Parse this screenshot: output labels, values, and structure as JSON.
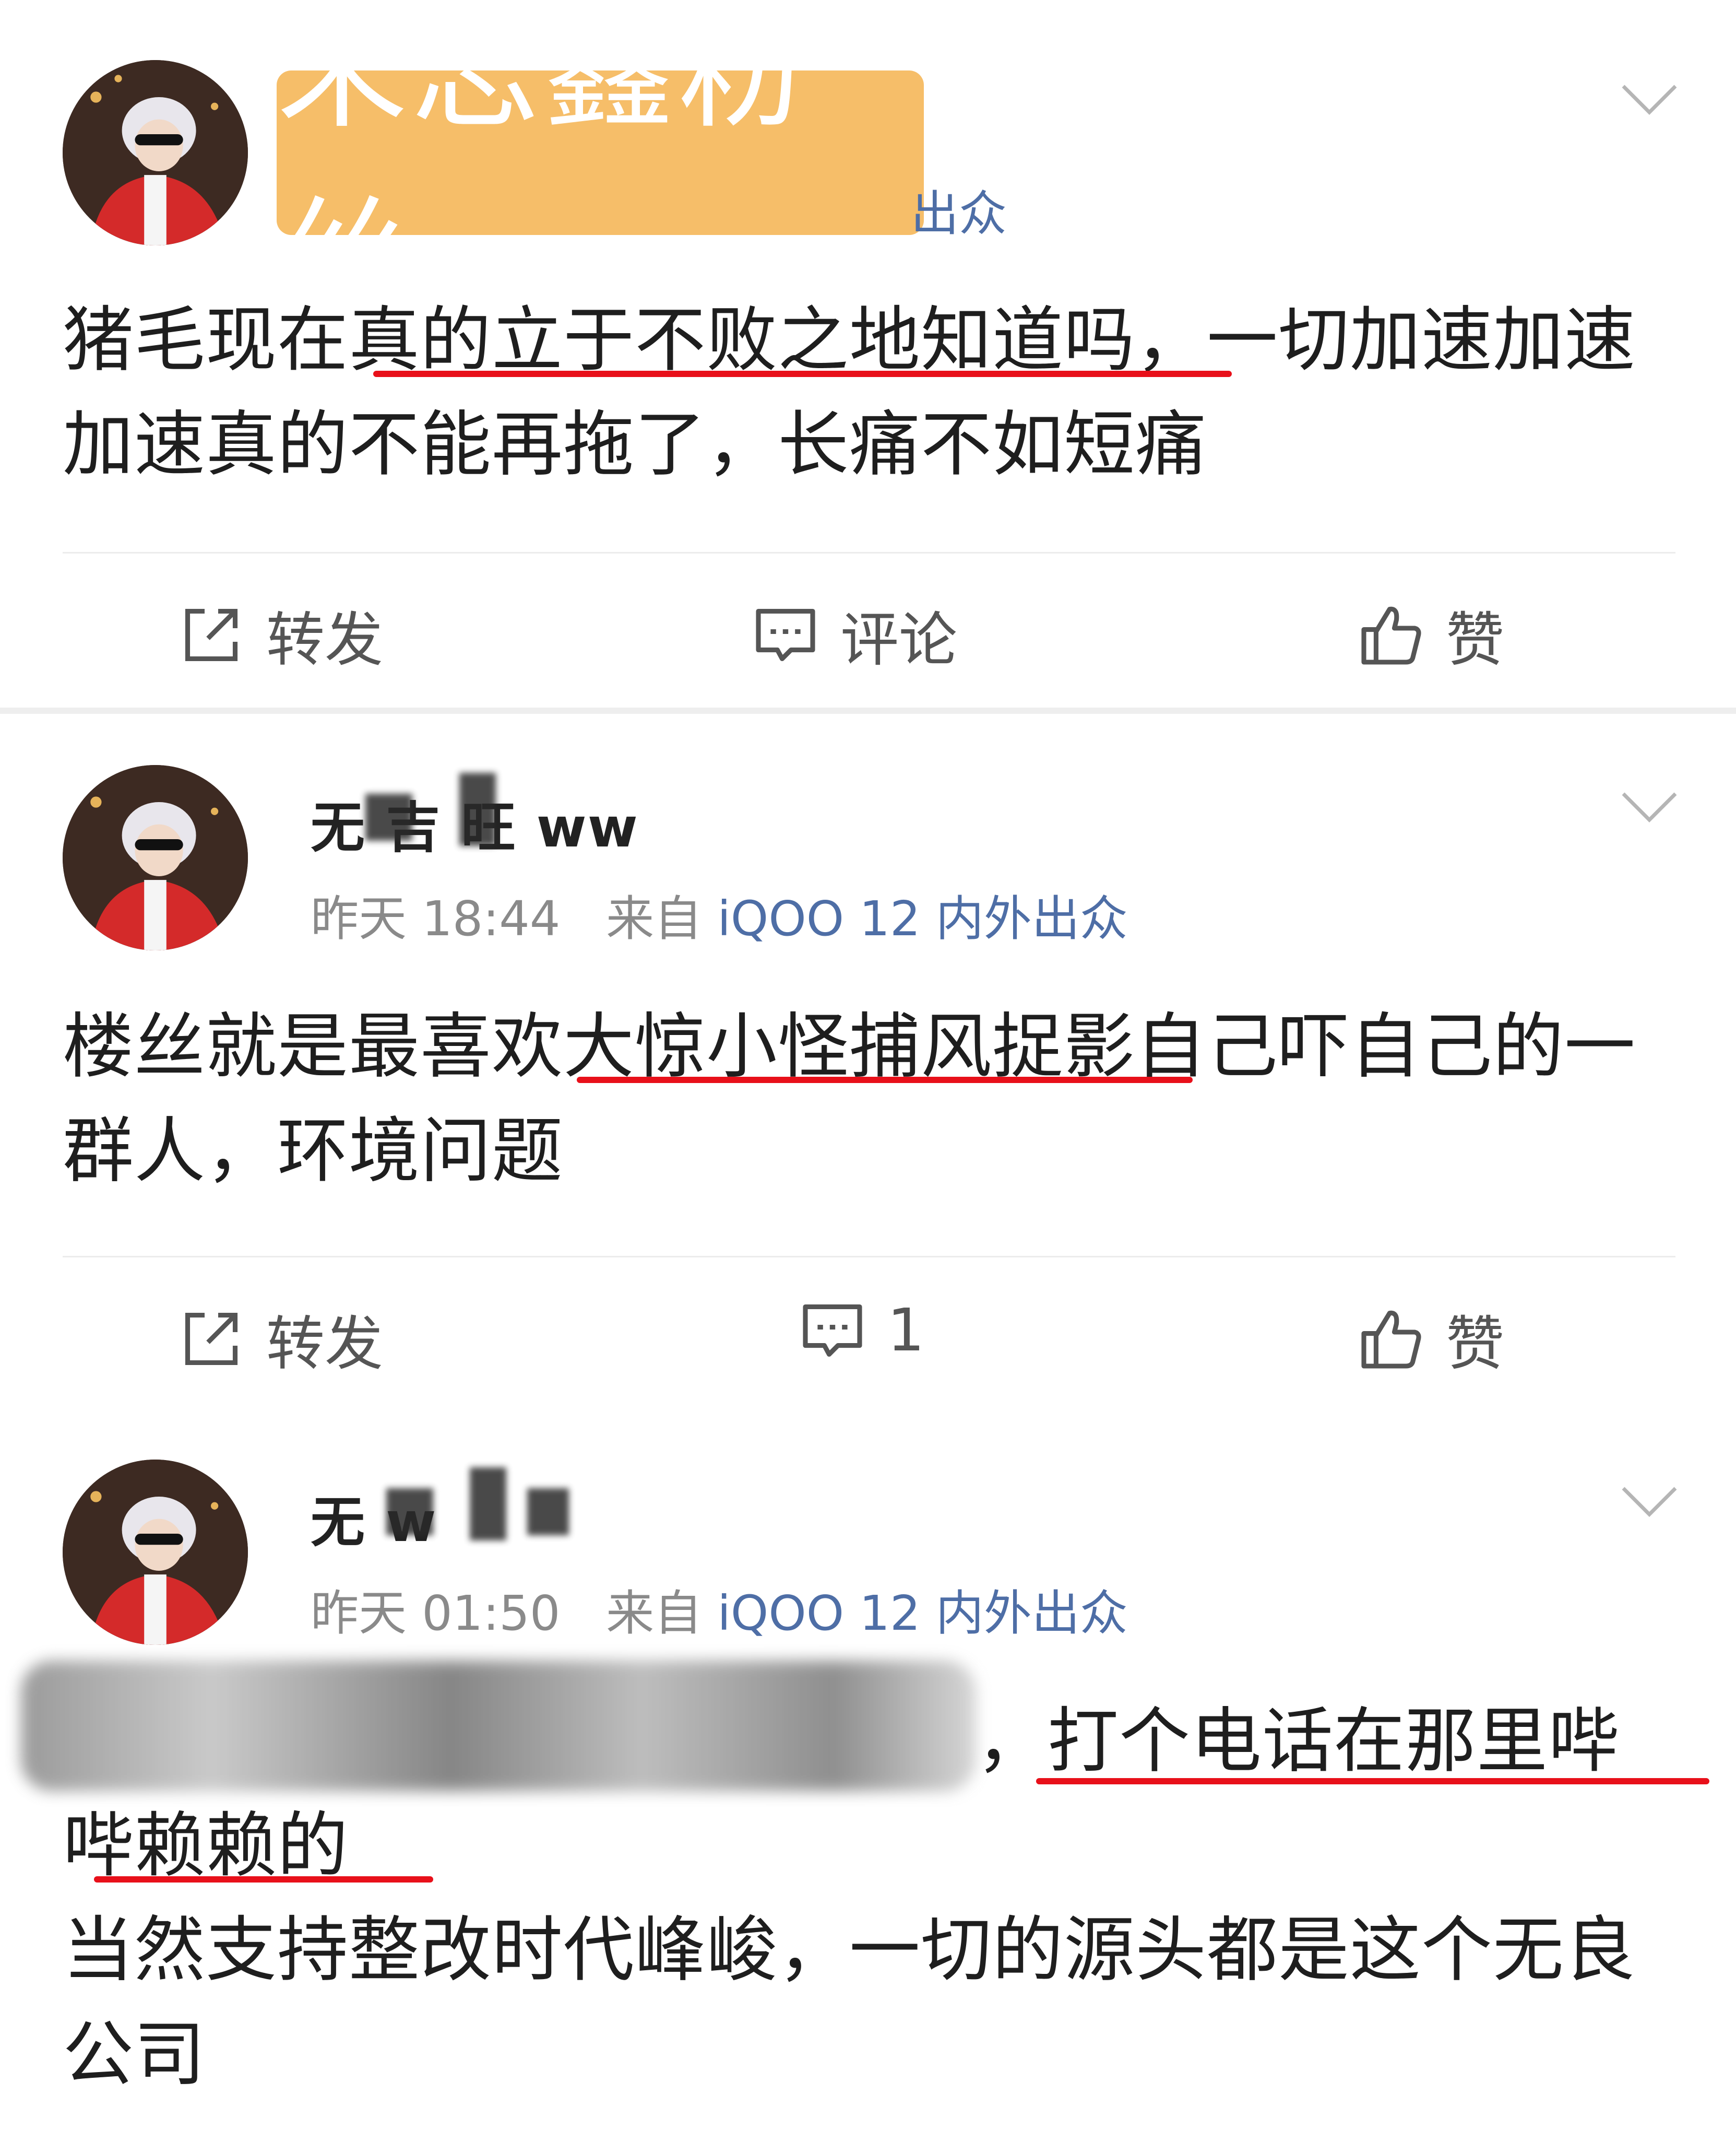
{
  "badge": {
    "label": "朱志鑫粉丝"
  },
  "posts": [
    {
      "partial_meta": "出众",
      "content": "猪毛现在真的立于不败之地知道吗，一切加速加速加速真的不能再拖了，长痛不如短痛",
      "actions": {
        "repost": "转发",
        "comment": "评论",
        "like": "赞"
      }
    },
    {
      "username_visible": "无 吉 旺 ww",
      "time": "昨天 18:44",
      "from_label": "来自",
      "source": "iQOO 12 内外出众",
      "content": "楼丝就是最喜欢大惊小怪捕风捉影自己吓自己的一群人，环境问题",
      "actions": {
        "repost": "转发",
        "comment": "1",
        "like": "赞"
      }
    },
    {
      "username_visible": "无 w",
      "time": "昨天 01:50",
      "from_label": "来自",
      "source": "iQOO 12 内外出众",
      "content_line1_visible": "，打个电话在那里哔",
      "content_line2": "哔赖赖的",
      "content_line3": "当然支持整改时代峰峻，一切的源头都是这个无良公司"
    }
  ],
  "colors": {
    "underline": "#e8101a",
    "badge": "#f6be69",
    "source_link": "#4e6ea6"
  },
  "icons": [
    "chevron-down-icon",
    "repost-icon",
    "comment-icon",
    "like-icon"
  ]
}
